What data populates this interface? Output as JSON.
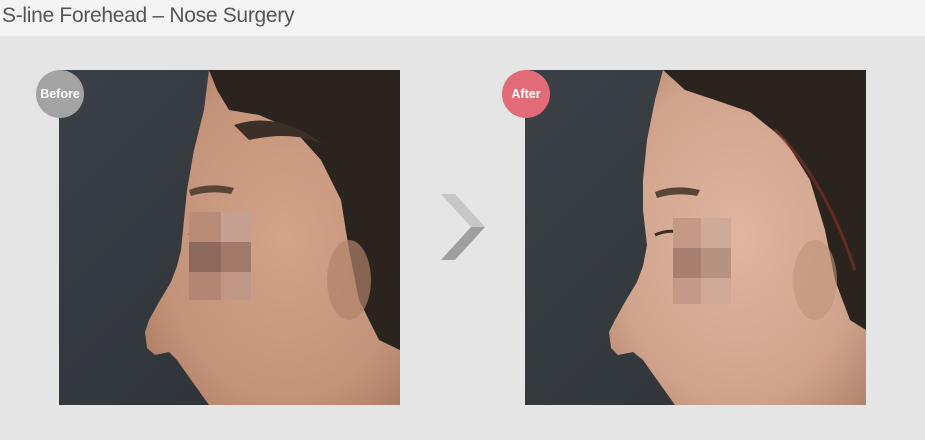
{
  "header": {
    "title": "S-line Forehead – Nose Surgery"
  },
  "photos": {
    "before": {
      "badge": "Before",
      "badge_color": "#a3a3a3"
    },
    "after": {
      "badge": "After",
      "badge_color": "#e16c78"
    }
  },
  "colors": {
    "background": "#e5e5e5",
    "arrow_light": "#c7c7c7",
    "arrow_dark": "#9f9f9f"
  }
}
